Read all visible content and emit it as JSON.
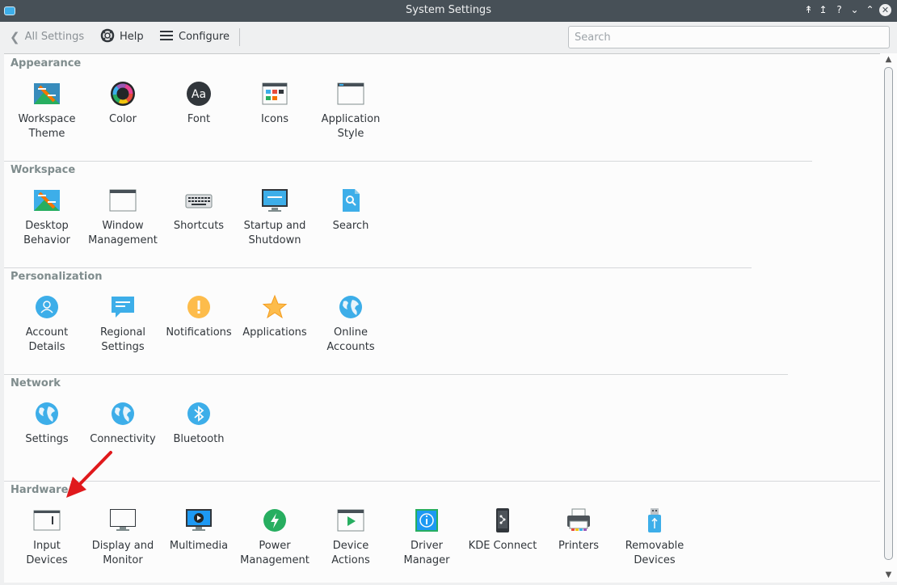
{
  "window": {
    "title": "System Settings",
    "buttons": [
      "keep-above",
      "keep-below",
      "help",
      "minimize",
      "maximize",
      "close"
    ]
  },
  "toolbar": {
    "back_label": "All Settings",
    "help_label": "Help",
    "configure_label": "Configure"
  },
  "search": {
    "placeholder": "Search",
    "value": ""
  },
  "colors": {
    "accent": "#3daee9",
    "titlebar": "#475057",
    "arrow": "#e0191c",
    "section_header": "#7f8c8d"
  },
  "sections": {
    "appearance": {
      "title": "Appearance",
      "items": [
        {
          "label": "Workspace\nTheme",
          "icon": "workspace-theme-icon"
        },
        {
          "label": "Color",
          "icon": "color-icon"
        },
        {
          "label": "Font",
          "icon": "font-icon"
        },
        {
          "label": "Icons",
          "icon": "icons-icon"
        },
        {
          "label": "Application\nStyle",
          "icon": "application-style-icon"
        }
      ]
    },
    "workspace": {
      "title": "Workspace",
      "items": [
        {
          "label": "Desktop\nBehavior",
          "icon": "desktop-behavior-icon"
        },
        {
          "label": "Window\nManagement",
          "icon": "window-management-icon"
        },
        {
          "label": "Shortcuts",
          "icon": "keyboard-icon"
        },
        {
          "label": "Startup and\nShutdown",
          "icon": "startup-shutdown-icon"
        },
        {
          "label": "Search",
          "icon": "search-icon"
        }
      ]
    },
    "personalization": {
      "title": "Personalization",
      "items": [
        {
          "label": "Account\nDetails",
          "icon": "account-icon"
        },
        {
          "label": "Regional\nSettings",
          "icon": "regional-icon"
        },
        {
          "label": "Notifications",
          "icon": "notifications-icon"
        },
        {
          "label": "Applications",
          "icon": "applications-star-icon"
        },
        {
          "label": "Online\nAccounts",
          "icon": "globe-icon"
        }
      ]
    },
    "network": {
      "title": "Network",
      "items": [
        {
          "label": "Settings",
          "icon": "globe-icon"
        },
        {
          "label": "Connectivity",
          "icon": "globe-icon"
        },
        {
          "label": "Bluetooth",
          "icon": "bluetooth-icon"
        }
      ]
    },
    "hardware": {
      "title": "Hardware",
      "items": [
        {
          "label": "Input\nDevices",
          "icon": "input-devices-icon"
        },
        {
          "label": "Display and\nMonitor",
          "icon": "monitor-icon"
        },
        {
          "label": "Multimedia",
          "icon": "multimedia-icon"
        },
        {
          "label": "Power\nManagement",
          "icon": "power-icon"
        },
        {
          "label": "Device\nActions",
          "icon": "device-actions-icon"
        },
        {
          "label": "Driver\nManager",
          "icon": "driver-manager-icon"
        },
        {
          "label": "KDE Connect",
          "icon": "kde-connect-icon"
        },
        {
          "label": "Printers",
          "icon": "printer-icon"
        },
        {
          "label": "Removable\nDevices",
          "icon": "usb-icon"
        }
      ]
    }
  }
}
